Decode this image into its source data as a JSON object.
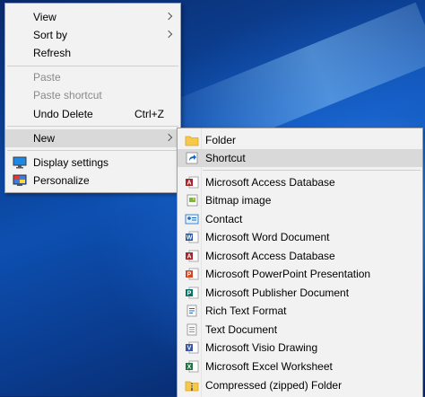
{
  "context_menu": {
    "items": [
      {
        "label": "View",
        "has_submenu": true,
        "disabled": false
      },
      {
        "label": "Sort by",
        "has_submenu": true,
        "disabled": false
      },
      {
        "label": "Refresh",
        "has_submenu": false,
        "disabled": false
      },
      {
        "label": "Paste",
        "has_submenu": false,
        "disabled": true
      },
      {
        "label": "Paste shortcut",
        "has_submenu": false,
        "disabled": true
      },
      {
        "label": "Undo Delete",
        "shortcut": "Ctrl+Z",
        "has_submenu": false,
        "disabled": false
      },
      {
        "label": "New",
        "has_submenu": true,
        "disabled": false,
        "active": true
      },
      {
        "label": "Display settings",
        "icon": "display-icon",
        "disabled": false
      },
      {
        "label": "Personalize",
        "icon": "personalize-icon",
        "disabled": false
      }
    ]
  },
  "new_submenu": {
    "items": [
      {
        "label": "Folder",
        "icon": "folder-icon"
      },
      {
        "label": "Shortcut",
        "icon": "shortcut-icon",
        "active": true
      },
      {
        "label": "Microsoft Access Database",
        "icon": "access-icon"
      },
      {
        "label": "Bitmap image",
        "icon": "bitmap-icon"
      },
      {
        "label": "Contact",
        "icon": "contact-icon"
      },
      {
        "label": "Microsoft Word Document",
        "icon": "word-icon"
      },
      {
        "label": "Microsoft Access Database",
        "icon": "access-icon"
      },
      {
        "label": "Microsoft PowerPoint Presentation",
        "icon": "powerpoint-icon"
      },
      {
        "label": "Microsoft Publisher Document",
        "icon": "publisher-icon"
      },
      {
        "label": "Rich Text Format",
        "icon": "rtf-icon"
      },
      {
        "label": "Text Document",
        "icon": "text-document-icon"
      },
      {
        "label": "Microsoft Visio Drawing",
        "icon": "visio-icon"
      },
      {
        "label": "Microsoft Excel Worksheet",
        "icon": "excel-icon"
      },
      {
        "label": "Compressed (zipped) Folder",
        "icon": "zip-folder-icon"
      }
    ]
  },
  "colors": {
    "menu_bg": "#f2f2f2",
    "hover_bg": "#d9d9d9",
    "disabled_text": "#8a8a8a"
  }
}
